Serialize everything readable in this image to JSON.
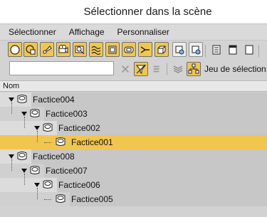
{
  "window": {
    "title": "Sélectionner dans la scène"
  },
  "menu": {
    "items": [
      "Sélectionner",
      "Affichage",
      "Personnaliser"
    ]
  },
  "toolbar": {
    "type_filters": [
      "geometry-icon",
      "shapes-icon",
      "lights-icon",
      "cameras-icon",
      "helpers-icon",
      "space-warps-icon",
      "groups-icon",
      "xrefs-icon",
      "bones-icon",
      "containers-icon",
      "frozen-icon",
      "hidden-icon"
    ],
    "display_buttons": [
      "list-view-icon",
      "document-icon",
      "window-icon"
    ]
  },
  "filter": {
    "value": ""
  },
  "selection_set": {
    "label": "Jeu de sélection:"
  },
  "columns": {
    "name": "Nom"
  },
  "tree": [
    {
      "label": "Factice004",
      "depth": 0,
      "expanded": true,
      "selected": false
    },
    {
      "label": "Factice003",
      "depth": 1,
      "expanded": true,
      "selected": false
    },
    {
      "label": "Factice002",
      "depth": 2,
      "expanded": true,
      "selected": false
    },
    {
      "label": "Factice001",
      "depth": 3,
      "expanded": false,
      "selected": true
    },
    {
      "label": "Factice008",
      "depth": 0,
      "expanded": true,
      "selected": false
    },
    {
      "label": "Factice007",
      "depth": 1,
      "expanded": true,
      "selected": false
    },
    {
      "label": "Factice006",
      "depth": 2,
      "expanded": true,
      "selected": false
    },
    {
      "label": "Factice005",
      "depth": 3,
      "expanded": false,
      "selected": false
    }
  ],
  "colors": {
    "accent": "#f1c64e",
    "row_light": "#dcdcdc",
    "row_dark": "#d0d0d0"
  }
}
